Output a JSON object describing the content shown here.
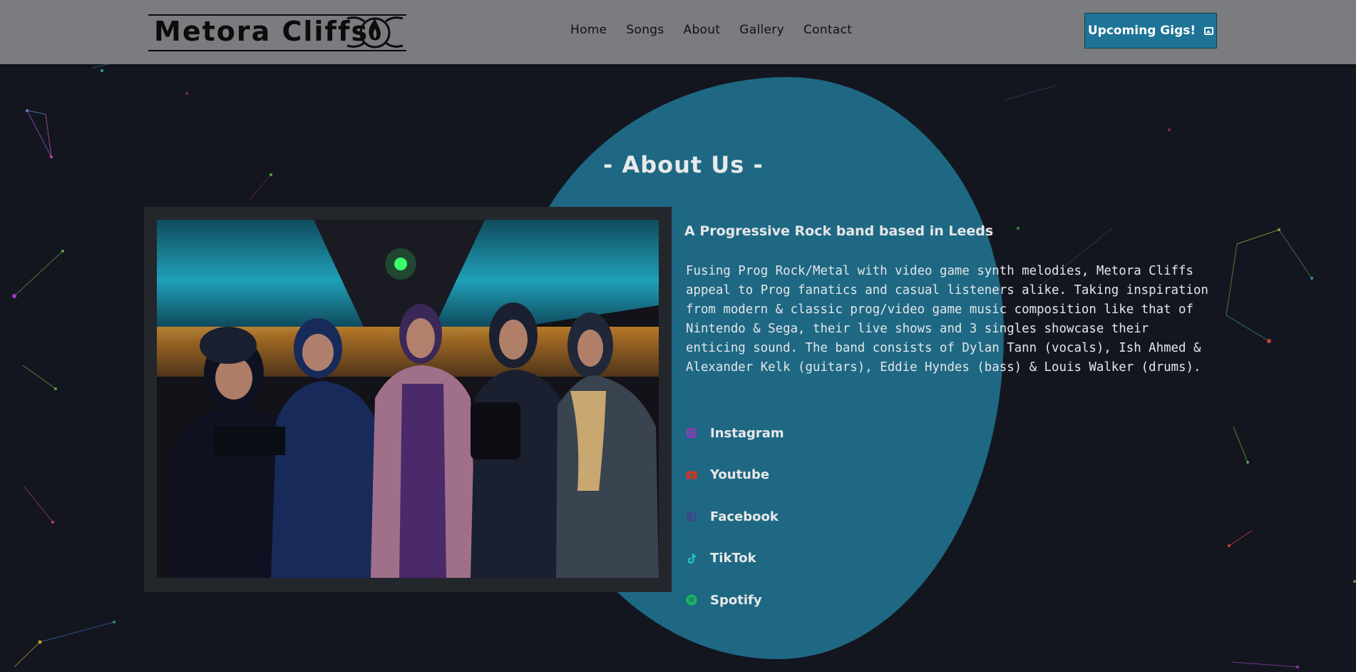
{
  "header": {
    "logo_text": "Metora Cliffs",
    "nav": [
      "Home",
      "Songs",
      "About",
      "Gallery",
      "Contact"
    ],
    "cta_label": "Upcoming Gigs!",
    "cta_icon": "image-icon"
  },
  "about": {
    "title": "- About Us -",
    "subtitle": "A Progressive Rock band based in Leeds",
    "description": "Fusing Prog Rock/Metal with video game synth melodies, Metora Cliffs appeal to Prog fanatics and casual listeners alike. Taking inspiration from modern & classic prog/video game music composition like that of Nintendo & Sega, their live shows and 3 singles showcase their enticing sound. The band consists of Dylan Tann (vocals), Ish Ahmed & Alexander Kelk (guitars), Eddie Hyndes (bass) & Louis Walker (drums).",
    "photo_alt": "Band photo of five members"
  },
  "socials": [
    {
      "label": "Instagram",
      "icon": "instagram-icon",
      "color": "#8e3db8"
    },
    {
      "label": "Youtube",
      "icon": "youtube-icon",
      "color": "#c0392b"
    },
    {
      "label": "Facebook",
      "icon": "facebook-icon",
      "color": "#3b4a8c"
    },
    {
      "label": "TikTok",
      "icon": "tiktok-icon",
      "color": "#25c4c4"
    },
    {
      "label": "Spotify",
      "icon": "spotify-icon",
      "color": "#1db954"
    }
  ],
  "colors": {
    "background": "#13161f",
    "header": "#7b7c80",
    "blob": "#1e6884",
    "cta": "#1d7497"
  }
}
